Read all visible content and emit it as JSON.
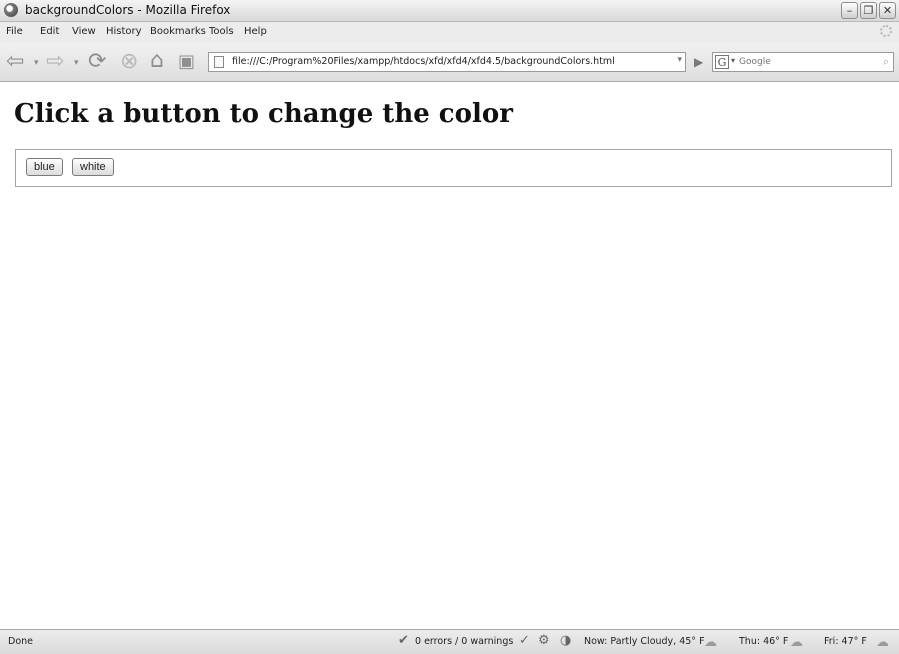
{
  "window": {
    "title": "backgroundColors - Mozilla Firefox"
  },
  "menu": [
    "File",
    "Edit",
    "View",
    "History",
    "Bookmarks",
    "Tools",
    "Help"
  ],
  "address": {
    "url": "file:///C:/Program%20Files/xampp/htdocs/xfd/xfd4/xfd4.5/backgroundColors.html"
  },
  "search": {
    "placeholder": "Google"
  },
  "page": {
    "heading": "Click a button to change the color",
    "buttons": [
      "blue",
      "white"
    ]
  },
  "status": {
    "text": "Done",
    "errors": "0 errors / 0 warnings",
    "weather_now": "Now: Partly Cloudy, 45° F",
    "weather_thu": "Thu: 46° F",
    "weather_fri": "Fri: 47° F"
  }
}
